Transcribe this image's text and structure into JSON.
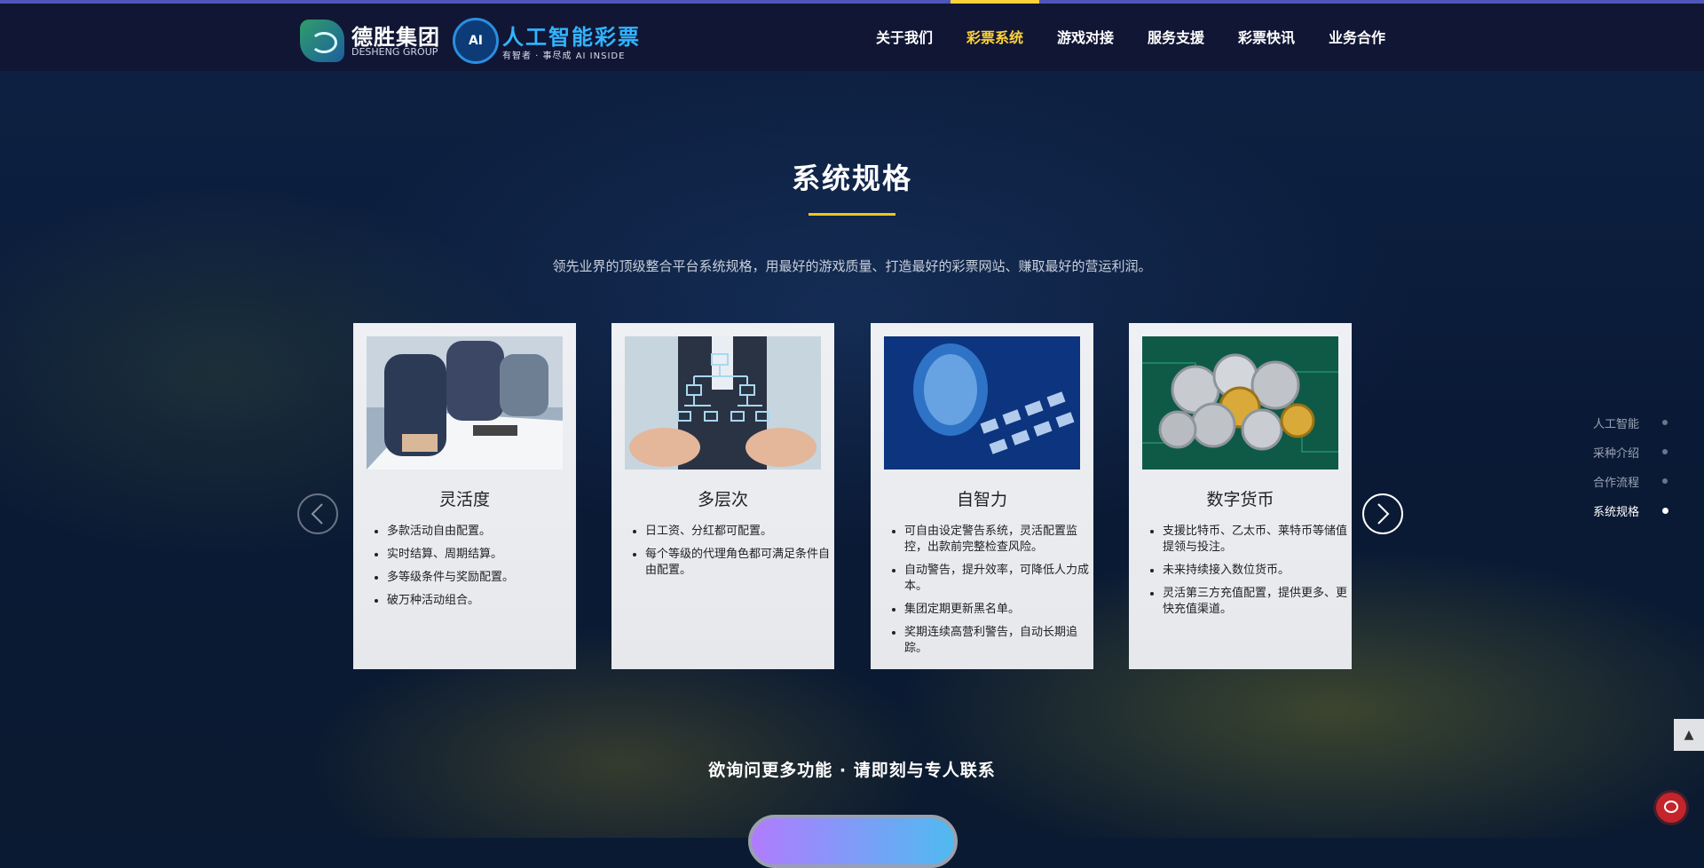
{
  "header": {
    "logo1": {
      "cn": "德胜集团",
      "en": "DESHENG GROUP"
    },
    "logo2": {
      "badge": "AI",
      "cn": "人工智能彩票",
      "slogan": "有智者 · 事尽成  AI INSIDE"
    },
    "nav": [
      {
        "label": "关于我们"
      },
      {
        "label": "彩票系统",
        "active": true
      },
      {
        "label": "游戏对接"
      },
      {
        "label": "服务支援"
      },
      {
        "label": "彩票快讯"
      },
      {
        "label": "业务合作"
      }
    ]
  },
  "section": {
    "title": "系统规格",
    "subtitle": "领先业界的顶级整合平台系统规格，用最好的游戏质量、打造最好的彩票网站、赚取最好的营运利润。"
  },
  "cards": [
    {
      "title": "灵活度",
      "image": "business-meeting",
      "items": [
        "多款活动自由配置。",
        "实时结算、周期结算。",
        "多等级条件与奖励配置。",
        "破万种活动组合。"
      ]
    },
    {
      "title": "多层次",
      "image": "hierarchy-hands",
      "items": [
        "日工资、分红都可配置。",
        "每个等级的代理角色都可满足条件自由配置。"
      ]
    },
    {
      "title": "自智力",
      "image": "ai-head-keyboard",
      "items": [
        "可自由设定警告系统，灵活配置监控，出款前完整检查风险。",
        "自动警告，提升效率，可降低人力成本。",
        "集团定期更新黑名单。",
        "奖期连续高营利警告，自动长期追踪。"
      ]
    },
    {
      "title": "数字货币",
      "image": "crypto-coins",
      "items": [
        "支援比特币、乙太币、莱特币等储值提领与投注。",
        "未来持续接入数位货币。",
        "灵活第三方充值配置，提供更多、更快充值渠道。"
      ]
    }
  ],
  "sidenav": [
    {
      "label": "人工智能"
    },
    {
      "label": "采种介绍"
    },
    {
      "label": "合作流程"
    },
    {
      "label": "系统规格",
      "active": true
    }
  ],
  "cta": {
    "text": "欲询问更多功能 · 请即刻与专人联系"
  },
  "controls": {
    "to_top": "▲",
    "prev": "‹",
    "next": "›"
  },
  "colors": {
    "accent": "#ffd23a",
    "nav_bg": "#12163a",
    "top_line": "#4e56b8"
  }
}
